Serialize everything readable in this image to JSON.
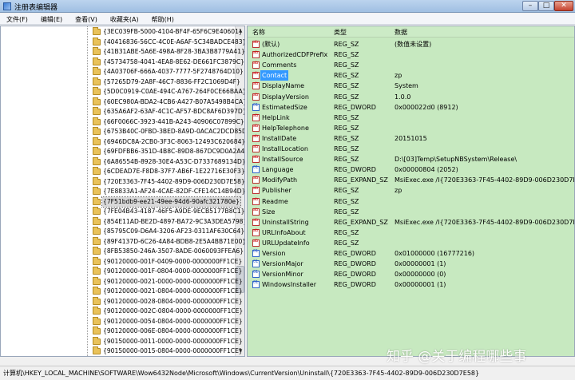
{
  "window": {
    "title": "注册表编辑器",
    "buttons": {
      "minimize": "–",
      "maximize": "□",
      "close": "✕"
    }
  },
  "menu": [
    "文件(F)",
    "编辑(E)",
    "查看(V)",
    "收藏夹(A)",
    "帮助(H)"
  ],
  "tree": {
    "selected_index": 17,
    "items": [
      "{3EC039FB-5000-4104-BF4F-65F6C9E40601}",
      "{40416836-56CC-4C0E-A6AF-5C34BADCE483}",
      "{41B31ABE-5A6E-498A-8F28-3BA3B8779A41}",
      "{45734758-4041-4EA8-8E62-DE661FC3879C}",
      "{4A03706F-666A-4037-7777-5F2748764D10}",
      "{57265D79-2A8F-46C7-8836-FF2C1069D4F}",
      "{5D0C0919-C0AE-494C-A767-264F0CE66BAA}",
      "{60EC980A-BDA2-4CB6-A427-B07A5498B4CA}",
      "{635A6AF2-63AF-4C1C-AF57-BDC8AF6D397D}",
      "{66F0066C-3923-441B-A243-40906C07899C}",
      "{6753B40C-0FBD-3BED-8A9D-0ACAC2DCD85D}",
      "{6946DC8A-2CB0-3F3C-8063-12493C620684}",
      "{69FDFBB6-351D-4B8C-89D8-867DC9D0A2A4}",
      "{6A86554B-8928-30E4-A53C-D7337689134D}",
      "{6CDEAD7E-F8D8-37F7-AB6F-1E22716E30F3}",
      "{720E3363-7F45-4402-89D9-006D230D7E58}",
      "{7E8833A1-AF24-4CAE-82DF-CFE14C14B94D}",
      "{7F51bdb9-ee21-49ee-94d6-90afc321780e}",
      "{7FE04B43-4187-46F5-A9DE-9ECB5177B8C1}",
      "{854E11AD-BE2D-4897-BA72-9C3A3DEA5798}",
      "{85795C09-D6A4-3206-AF23-0311AF630C64}",
      "{89F4137D-6C26-4A84-BDB8-2E5A4BB71E00}",
      "{8FB53850-246A-3507-8ADE-0060093FFEA6}",
      "{90120000-001F-0409-0000-0000000FF1CE}",
      "{90120000-001F-0804-0000-0000000FF1CE}",
      "{90120000-0021-0000-0000-0000000FF1CE}",
      "{90120000-0021-0804-0000-0000000FF1CE}",
      "{90120000-0028-0804-0000-0000000FF1CE}",
      "{90120000-002C-0804-0000-0000000FF1CE}",
      "{90120000-0054-0804-0000-0000000FF1CE}",
      "{90120000-006E-0804-0000-0000000FF1CE}",
      "{90150000-0011-0000-0000-0000000FF1CE}",
      "{90150000-0015-0804-0000-0000000FF1CE}"
    ]
  },
  "list": {
    "headers": {
      "name": "名称",
      "type": "类型",
      "data": "数据"
    },
    "selected_index": 3,
    "rows": [
      {
        "name": "(默认)",
        "type": "REG_SZ",
        "data": "(数值未设置)",
        "kind": "sz"
      },
      {
        "name": "AuthorizedCDFPrefix",
        "type": "REG_SZ",
        "data": "",
        "kind": "sz"
      },
      {
        "name": "Comments",
        "type": "REG_SZ",
        "data": "",
        "kind": "sz"
      },
      {
        "name": "Contact",
        "type": "REG_SZ",
        "data": "zp",
        "kind": "sz"
      },
      {
        "name": "DisplayName",
        "type": "REG_SZ",
        "data": "System",
        "kind": "sz"
      },
      {
        "name": "DisplayVersion",
        "type": "REG_SZ",
        "data": "1.0.0",
        "kind": "sz"
      },
      {
        "name": "EstimatedSize",
        "type": "REG_DWORD",
        "data": "0x000022d0 (8912)",
        "kind": "dw"
      },
      {
        "name": "HelpLink",
        "type": "REG_SZ",
        "data": "",
        "kind": "sz"
      },
      {
        "name": "HelpTelephone",
        "type": "REG_SZ",
        "data": "",
        "kind": "sz"
      },
      {
        "name": "InstallDate",
        "type": "REG_SZ",
        "data": "20151015",
        "kind": "sz"
      },
      {
        "name": "InstallLocation",
        "type": "REG_SZ",
        "data": "",
        "kind": "sz"
      },
      {
        "name": "InstallSource",
        "type": "REG_SZ",
        "data": "D:\\[03]Temp\\SetupNBSystem\\Release\\",
        "kind": "sz"
      },
      {
        "name": "Language",
        "type": "REG_DWORD",
        "data": "0x00000804 (2052)",
        "kind": "dw"
      },
      {
        "name": "ModifyPath",
        "type": "REG_EXPAND_SZ",
        "data": "MsiExec.exe /I{720E3363-7F45-4402-89D9-006D230D7E58}",
        "kind": "sz"
      },
      {
        "name": "Publisher",
        "type": "REG_SZ",
        "data": "zp",
        "kind": "sz"
      },
      {
        "name": "Readme",
        "type": "REG_SZ",
        "data": "",
        "kind": "sz"
      },
      {
        "name": "Size",
        "type": "REG_SZ",
        "data": "",
        "kind": "sz"
      },
      {
        "name": "UninstallString",
        "type": "REG_EXPAND_SZ",
        "data": "MsiExec.exe /I{720E3363-7F45-4402-89D9-006D230D7E58}",
        "kind": "sz"
      },
      {
        "name": "URLInfoAbout",
        "type": "REG_SZ",
        "data": "",
        "kind": "sz"
      },
      {
        "name": "URLUpdateInfo",
        "type": "REG_SZ",
        "data": "",
        "kind": "sz"
      },
      {
        "name": "Version",
        "type": "REG_DWORD",
        "data": "0x01000000 (16777216)",
        "kind": "dw"
      },
      {
        "name": "VersionMajor",
        "type": "REG_DWORD",
        "data": "0x00000001 (1)",
        "kind": "dw"
      },
      {
        "name": "VersionMinor",
        "type": "REG_DWORD",
        "data": "0x00000000 (0)",
        "kind": "dw"
      },
      {
        "name": "WindowsInstaller",
        "type": "REG_DWORD",
        "data": "0x00000001 (1)",
        "kind": "dw"
      }
    ]
  },
  "status": {
    "path": "计算机\\HKEY_LOCAL_MACHINE\\SOFTWARE\\Wow6432Node\\Microsoft\\Windows\\CurrentVersion\\Uninstall\\{720E3363-7F45-4402-89D9-006D230D7E58}"
  },
  "watermark": "知乎 @关于编程哪些事",
  "colors": {
    "list_bg": "#c7e9c0",
    "selection": "#3399ff",
    "folder": "#e9c25a"
  }
}
